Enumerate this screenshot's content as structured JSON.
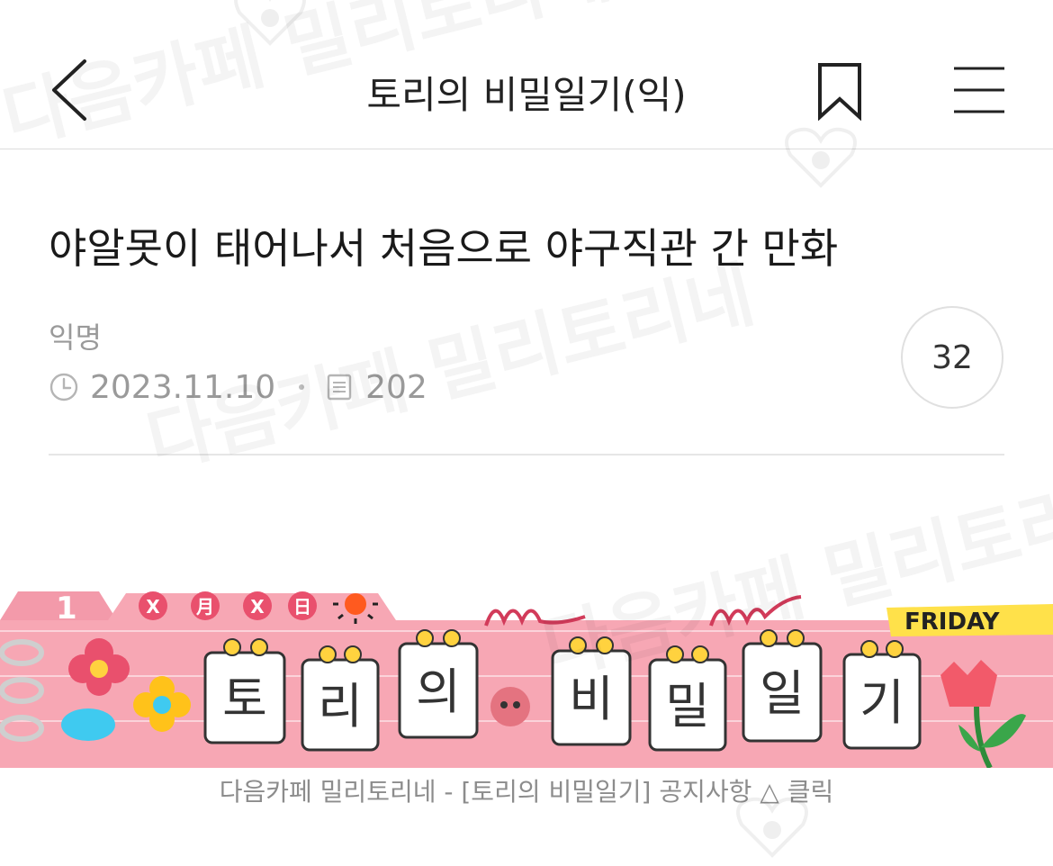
{
  "header": {
    "title": "토리의 비밀일기(익)",
    "back_icon": "chevron-left-icon",
    "bookmark_icon": "bookmark-icon",
    "menu_icon": "hamburger-menu-icon"
  },
  "post": {
    "title": "야알못이 태어나서 처음으로 야구직관 간 만화",
    "author": "익명",
    "date": "2023.11.10",
    "views": "202",
    "comment_count": "32"
  },
  "banner": {
    "tab_number": "1",
    "date_chars": [
      "X",
      "月",
      "X",
      "日"
    ],
    "day_label": "FRIDAY",
    "title_chars": [
      "토",
      "리",
      "의",
      "비",
      "밀",
      "일",
      "기"
    ],
    "caption": "다음카페 밀리토리네 - [토리의 비밀일기] 공지사항 △ 클릭"
  },
  "watermark": {
    "text": "다음카페 밀리토리네"
  },
  "colors": {
    "banner_pink": "#f7a7b4",
    "banner_dark_pink": "#ef8c9e",
    "accent_red": "#d23b5a",
    "meta_gray": "#9a9a9a"
  }
}
